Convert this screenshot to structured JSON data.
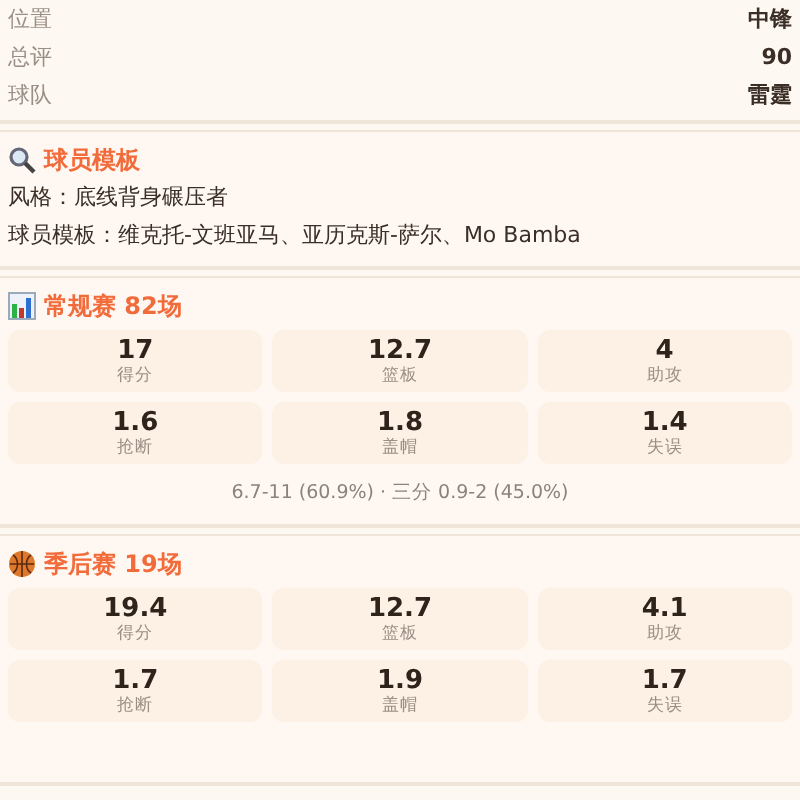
{
  "info_rows": [
    {
      "label": "位置",
      "value": "中锋"
    },
    {
      "label": "总评",
      "value": "90"
    },
    {
      "label": "球队",
      "value": "雷霆"
    }
  ],
  "template": {
    "title": "球员模板",
    "lines": [
      "风格：底线背身碾压者",
      "球员模板：维克托-文班亚马、亚历克斯-萨尔、Mo Bamba"
    ]
  },
  "sections": [
    {
      "kind": "chart",
      "title": "常规赛 82场",
      "stats": [
        {
          "value": "17",
          "label": "得分"
        },
        {
          "value": "12.7",
          "label": "篮板"
        },
        {
          "value": "4",
          "label": "助攻"
        },
        {
          "value": "1.6",
          "label": "抢断"
        },
        {
          "value": "1.8",
          "label": "盖帽"
        },
        {
          "value": "1.4",
          "label": "失误"
        }
      ],
      "shooting": "6.7-11 (60.9%) · 三分 0.9-2 (45.0%)"
    },
    {
      "kind": "ball",
      "title": "季后赛 19场",
      "stats": [
        {
          "value": "19.4",
          "label": "得分"
        },
        {
          "value": "12.7",
          "label": "篮板"
        },
        {
          "value": "4.1",
          "label": "助攻"
        },
        {
          "value": "1.7",
          "label": "抢断"
        },
        {
          "value": "1.9",
          "label": "盖帽"
        },
        {
          "value": "1.7",
          "label": "失误"
        }
      ]
    }
  ]
}
